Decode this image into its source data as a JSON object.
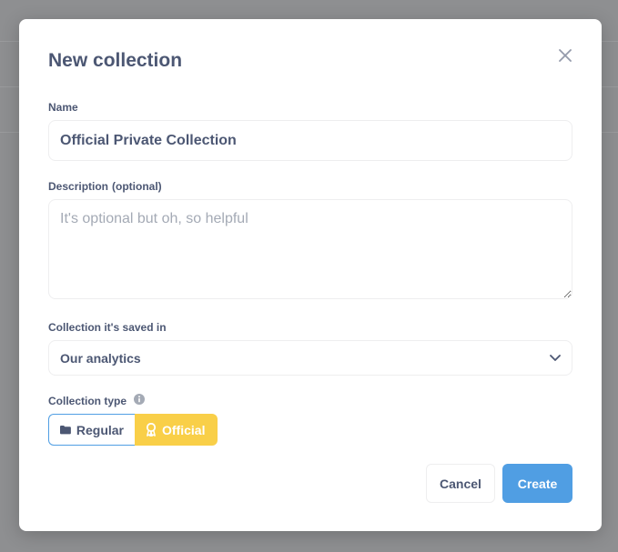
{
  "modal": {
    "title": "New collection",
    "close_icon": "close-icon"
  },
  "name_field": {
    "label": "Name",
    "value": "Official Private Collection"
  },
  "description_field": {
    "label": "Description",
    "optional_tag": "(optional)",
    "value": "",
    "placeholder": "It's optional but oh, so helpful"
  },
  "parent_collection": {
    "label": "Collection it's saved in",
    "selected": "Our analytics",
    "icon": "chevron-down-icon"
  },
  "collection_type": {
    "label": "Collection type",
    "info_icon": "info-icon",
    "options": [
      {
        "label": "Regular",
        "icon": "folder-icon",
        "selected": false
      },
      {
        "label": "Official",
        "icon": "badge-icon",
        "selected": true
      }
    ],
    "official_color": "#F9CF48"
  },
  "actions": {
    "cancel_label": "Cancel",
    "create_label": "Create"
  },
  "colors": {
    "brand": "#509EE3",
    "text": "#4C5773",
    "border": "#EEEEEF"
  }
}
